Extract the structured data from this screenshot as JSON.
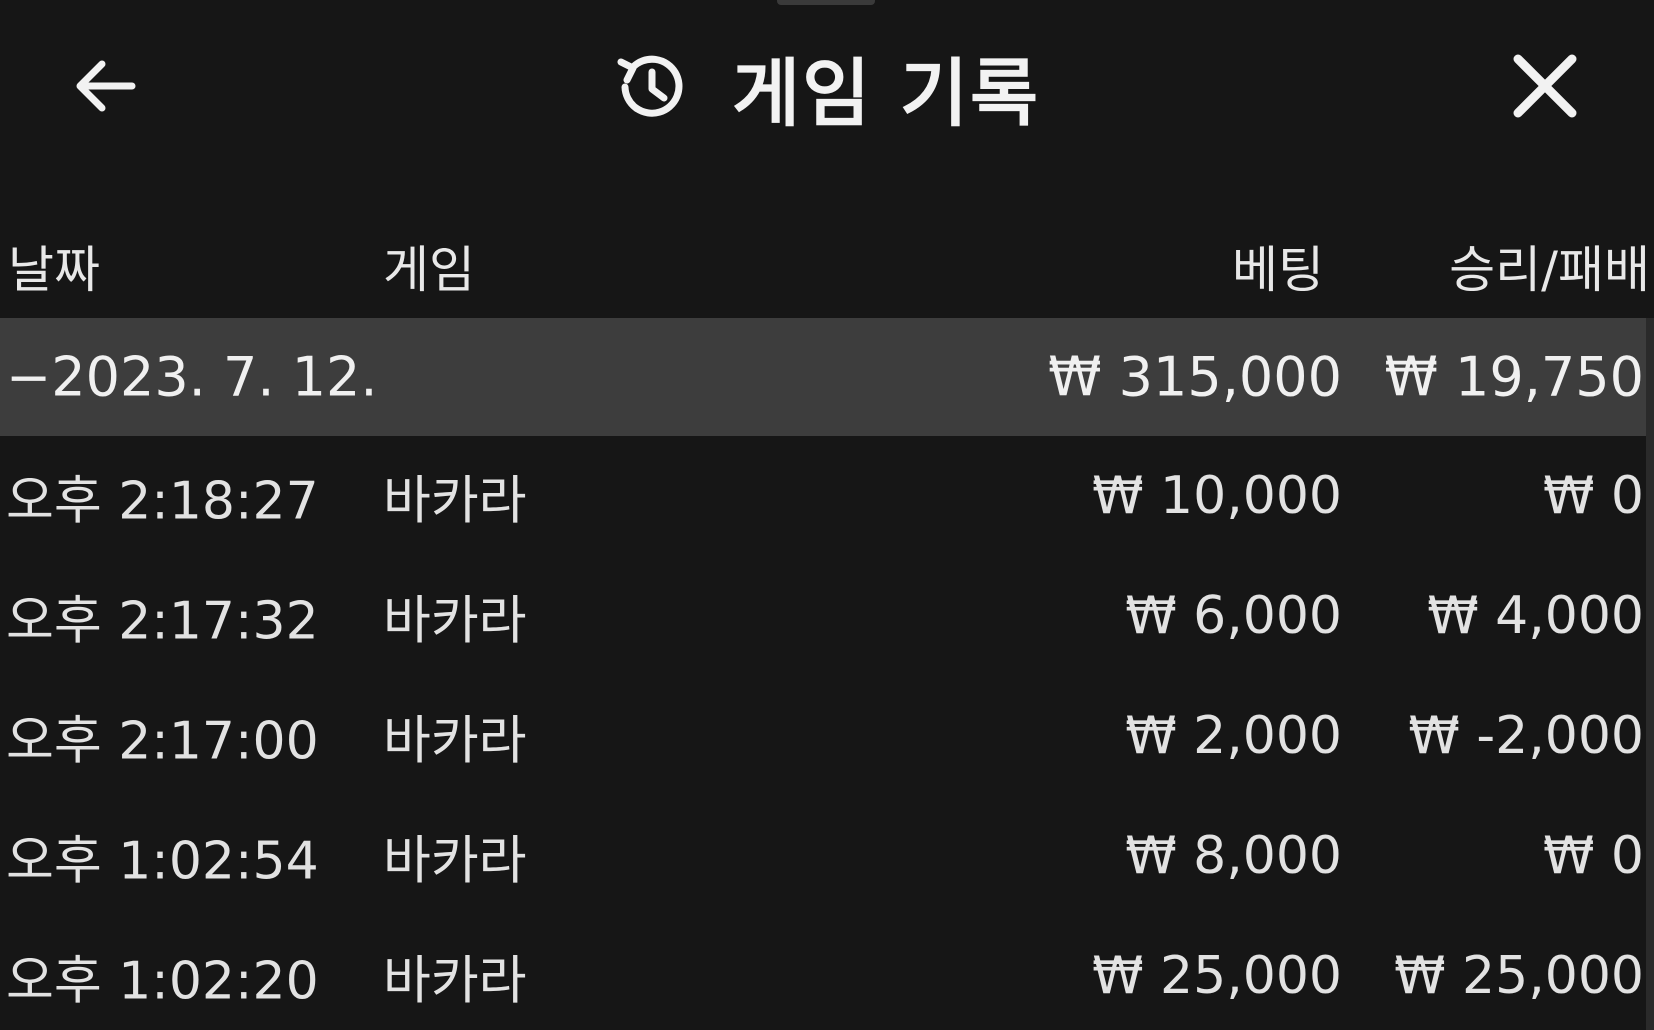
{
  "header": {
    "title": "게임 기록",
    "back_icon": "arrow-left-icon",
    "history_icon": "history-clock-icon",
    "close_icon": "close-icon"
  },
  "table": {
    "columns": {
      "date": "날짜",
      "game": "게임",
      "bet": "베팅",
      "result": "승리/패배"
    },
    "date_group": {
      "date": "−2023. 7. 12.",
      "bet_total": "₩ 315,000",
      "result_total": "₩ 19,750"
    },
    "rows": [
      {
        "time": "오후 2:18:27",
        "game": "바카라",
        "bet": "₩ 10,000",
        "result": "₩ 0"
      },
      {
        "time": "오후 2:17:32",
        "game": "바카라",
        "bet": "₩ 6,000",
        "result": "₩ 4,000"
      },
      {
        "time": "오후 2:17:00",
        "game": "바카라",
        "bet": "₩ 2,000",
        "result": "₩ -2,000"
      },
      {
        "time": "오후 1:02:54",
        "game": "바카라",
        "bet": "₩ 8,000",
        "result": "₩ 0"
      },
      {
        "time": "오후 1:02:20",
        "game": "바카라",
        "bet": "₩ 25,000",
        "result": "₩ 25,000"
      }
    ]
  },
  "colors": {
    "background": "#161616",
    "date_row_background": "#3d3d3d",
    "text": "#e6e6e6"
  }
}
